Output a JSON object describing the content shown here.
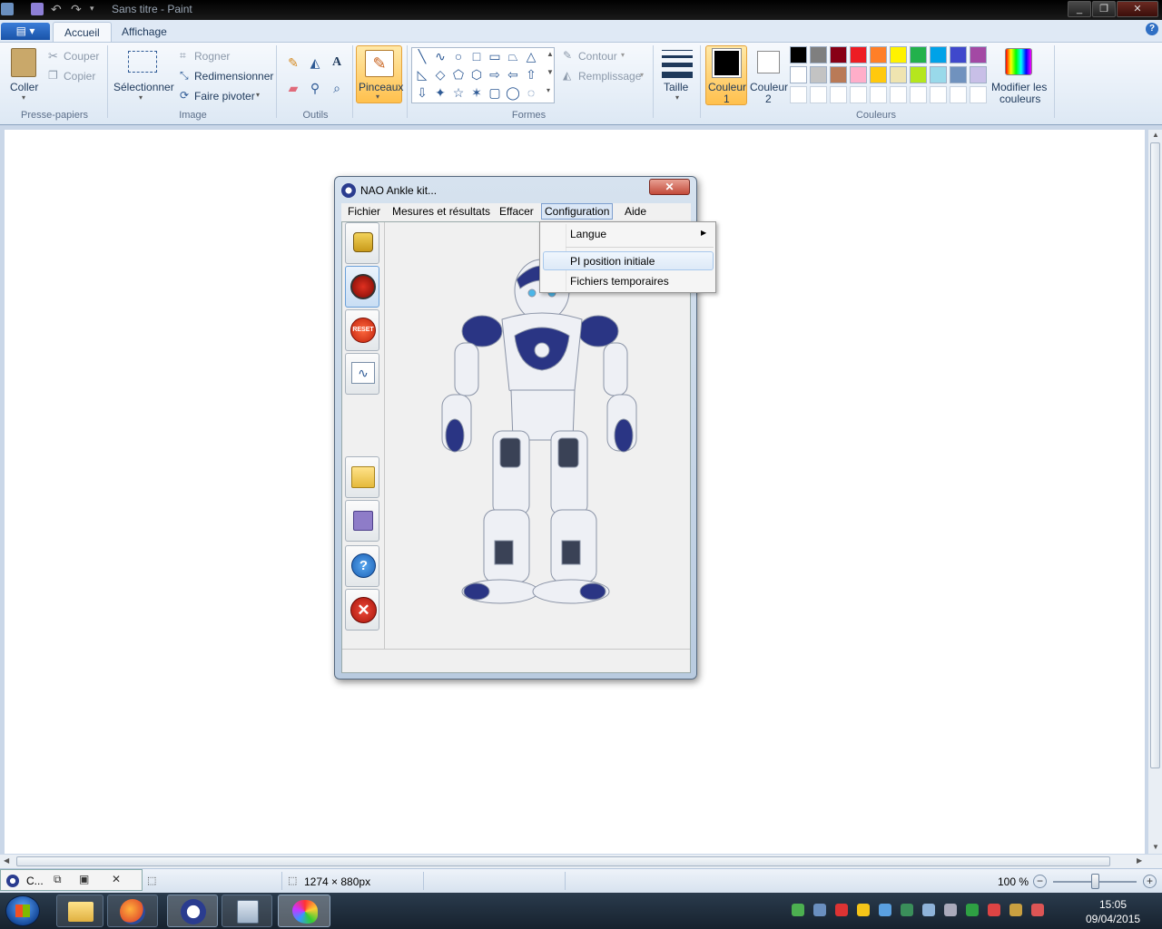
{
  "titlebar": {
    "title": "Sans titre - Paint"
  },
  "tabs": {
    "file": "▤ ▾",
    "home": "Accueil",
    "view": "Affichage",
    "help": "?"
  },
  "clipboard": {
    "paste": "Coller",
    "cut": "Couper",
    "copy": "Copier",
    "group": "Presse-papiers"
  },
  "image": {
    "select": "Sélectionner",
    "crop": "Rogner",
    "resize": "Redimensionner",
    "rotate": "Faire pivoter",
    "group": "Image"
  },
  "tools": {
    "group": "Outils",
    "text_tool": "A"
  },
  "brushes": {
    "label": "Pinceaux"
  },
  "shapes": {
    "outline": "Contour",
    "fill": "Remplissage",
    "group": "Formes"
  },
  "size": {
    "label": "Taille"
  },
  "colors": {
    "color1_line1": "Couleur",
    "color1_line2": "1",
    "color2_line1": "Couleur",
    "color2_line2": "2",
    "edit_line1": "Modifier les",
    "edit_line2": "couleurs",
    "group": "Couleurs",
    "row1": [
      "#000000",
      "#7f7f7f",
      "#880015",
      "#ed1c24",
      "#ff7f27",
      "#fff200",
      "#22b14c",
      "#00a2e8",
      "#3f48cc",
      "#a349a4"
    ],
    "row2": [
      "#ffffff",
      "#c3c3c3",
      "#b97a57",
      "#ffaec9",
      "#ffc90e",
      "#efe4b0",
      "#b5e61d",
      "#99d9ea",
      "#7092be",
      "#c8bfe7"
    ]
  },
  "dialog": {
    "title": "NAO Ankle kit...",
    "close": "✕",
    "menu": [
      "Fichier",
      "Mesures et résultats",
      "Effacer",
      "Configuration",
      "Aide"
    ],
    "reset_label": "RESET",
    "help_glyph": "?"
  },
  "dropdown": {
    "items": [
      "Langue",
      "PI position initiale",
      "Fichiers temporaires"
    ],
    "submenu_arrow": "▶"
  },
  "statusbar": {
    "dimensions": "1274 × 880px",
    "zoom": "100 %",
    "minus": "−",
    "plus": "+"
  },
  "taskbar_thumb": {
    "label": "C..."
  },
  "clock": {
    "time": "15:05",
    "date": "09/04/2015"
  }
}
